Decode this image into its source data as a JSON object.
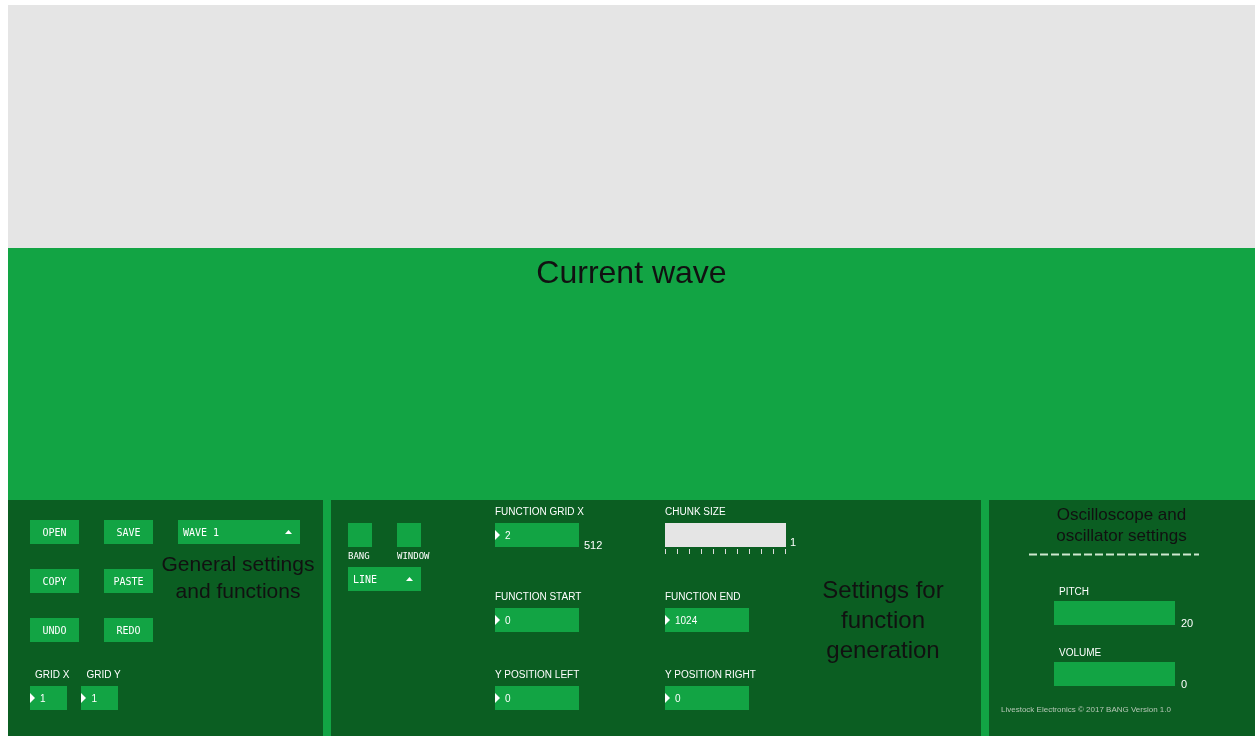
{
  "wave_view": {
    "annotation": "Current wave"
  },
  "general": {
    "annotation": "General settings and functions",
    "buttons": [
      {
        "label": "OPEN"
      },
      {
        "label": "SAVE"
      },
      {
        "label": "COPY"
      },
      {
        "label": "PASTE"
      },
      {
        "label": "UNDO"
      },
      {
        "label": "REDO"
      }
    ],
    "wave_select": {
      "value": "WAVE 1"
    },
    "grid_fields": [
      {
        "label": "GRID X",
        "value": "1"
      },
      {
        "label": "GRID Y",
        "value": "1"
      }
    ]
  },
  "function_gen": {
    "annotation": "Settings for function generation",
    "toggles": [
      {
        "label": "BANG"
      },
      {
        "label": "WINDOW"
      }
    ],
    "mode_select": {
      "value": "LINE"
    },
    "fields": [
      {
        "kind": "number",
        "label": "FUNCTION GRID X",
        "value": "2",
        "reading": "512"
      },
      {
        "kind": "slider",
        "label": "CHUNK SIZE",
        "reading": "1"
      },
      {
        "kind": "number",
        "label": "FUNCTION START",
        "value": "0"
      },
      {
        "kind": "number",
        "label": "FUNCTION END",
        "value": "1024"
      },
      {
        "kind": "number",
        "label": "Y POSITION LEFT",
        "value": "0"
      },
      {
        "kind": "number",
        "label": "Y POSITION RIGHT",
        "value": "0"
      }
    ]
  },
  "oscillator": {
    "annotation": "Oscilloscope and oscillator settings",
    "sliders": [
      {
        "label": "PITCH",
        "reading": "20"
      },
      {
        "label": "VOLUME",
        "reading": "0"
      }
    ],
    "footer": "Livestock Electronics © 2017 BANG Version 1.0"
  }
}
